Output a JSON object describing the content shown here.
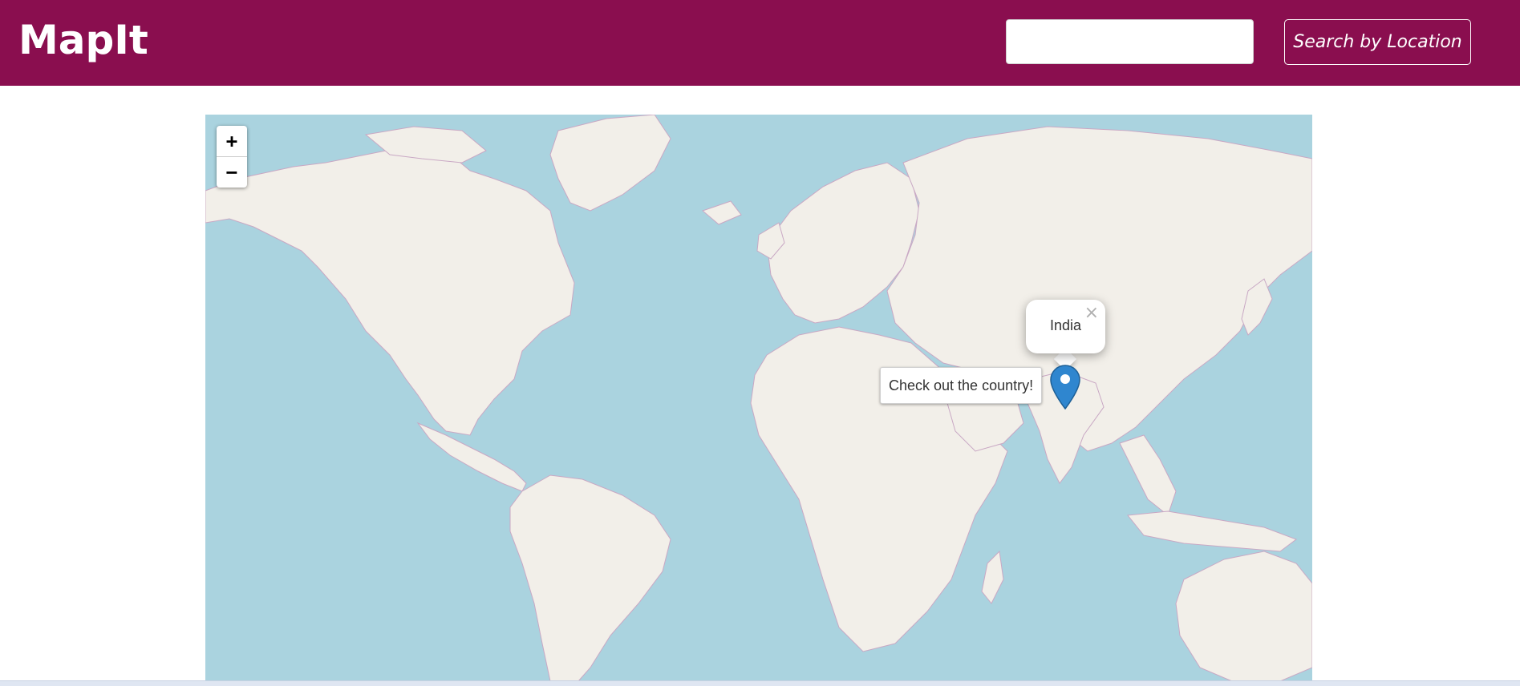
{
  "header": {
    "brand": "MapIt",
    "search_placeholder": "",
    "search_value": "",
    "search_button_label": "Search by Location",
    "background_color": "#8a0e4f"
  },
  "map": {
    "zoom_in_label": "+",
    "zoom_out_label": "−",
    "marker": {
      "icon": "map-pin-icon",
      "color": "#2f86cf",
      "tooltip": "Check out the country!",
      "popup_text": "India",
      "popup_close_label": "×"
    },
    "colors": {
      "water": "#aad3df",
      "land": "#f2efe9",
      "borders": "#c9a8c4"
    }
  }
}
